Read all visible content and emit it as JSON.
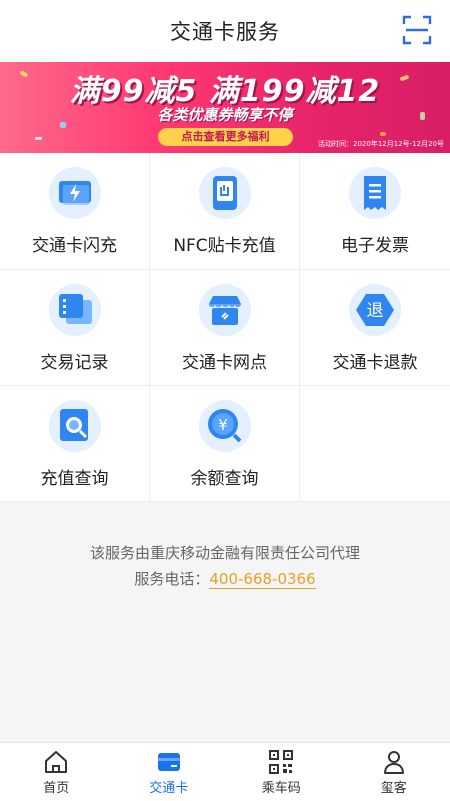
{
  "header": {
    "title": "交通卡服务"
  },
  "banner": {
    "line1": "满99减5 满199减12",
    "line2": "各类优惠券畅享不停",
    "cta": "点击查看更多福利",
    "date": "活动时间：2020年12月12号-12月20号"
  },
  "services": [
    {
      "label": "交通卡闪充",
      "icon": "lightning-card-icon"
    },
    {
      "label": "NFC贴卡充值",
      "icon": "nfc-phone-icon"
    },
    {
      "label": "电子发票",
      "icon": "receipt-icon"
    },
    {
      "label": "交易记录",
      "icon": "records-icon"
    },
    {
      "label": "交通卡网点",
      "icon": "store-icon"
    },
    {
      "label": "交通卡退款",
      "icon": "refund-icon"
    },
    {
      "label": "充值查询",
      "icon": "search-doc-icon"
    },
    {
      "label": "余额查询",
      "icon": "yen-search-icon"
    }
  ],
  "info": {
    "agent": "该服务由重庆移动金融有限责任公司代理",
    "phone_label": "服务电话：",
    "phone": "400-668-0366"
  },
  "tabs": [
    {
      "label": "首页",
      "icon": "home-icon"
    },
    {
      "label": "交通卡",
      "icon": "card-icon"
    },
    {
      "label": "乘车码",
      "icon": "qr-code-icon"
    },
    {
      "label": "玺客",
      "icon": "user-icon"
    }
  ],
  "colors": {
    "accent": "#1a73e8",
    "phone": "#e9a21f",
    "banner": "#e8246a"
  }
}
